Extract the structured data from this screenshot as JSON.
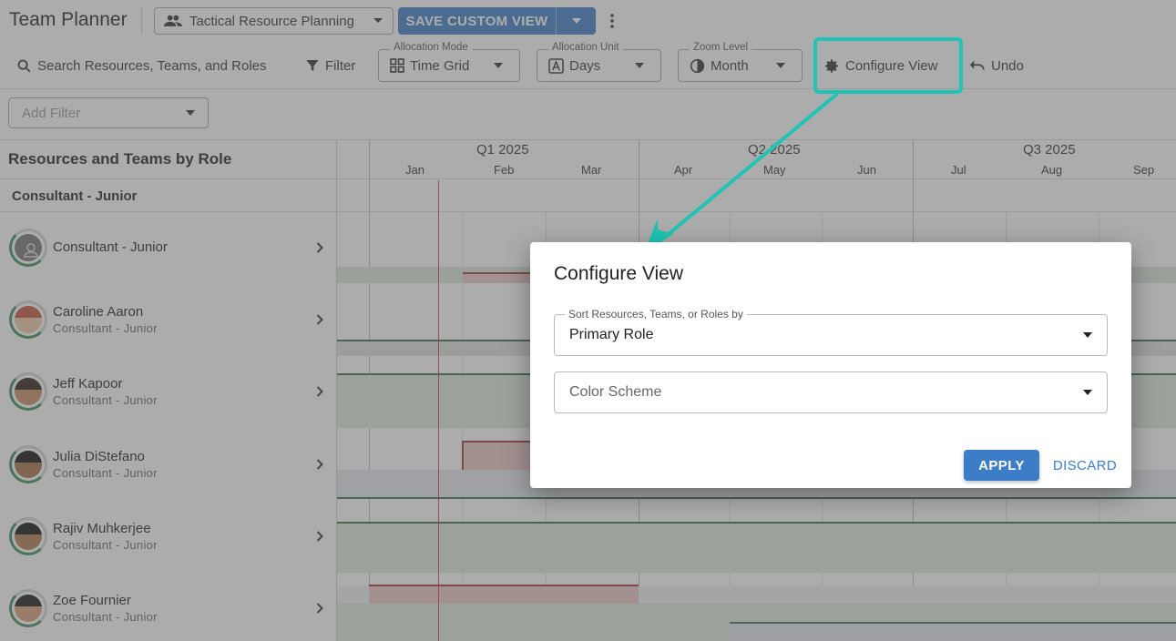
{
  "app": {
    "title": "Team Planner"
  },
  "view_selector": {
    "value": "Tactical Resource Planning"
  },
  "save_view": {
    "label": "SAVE CUSTOM VIEW"
  },
  "toolbar": {
    "search_label": "Search Resources, Teams, and Roles",
    "filter_label": "Filter",
    "allocation_mode": {
      "legend": "Allocation Mode",
      "value": "Time Grid"
    },
    "allocation_unit": {
      "legend": "Allocation Unit",
      "value": "Days"
    },
    "zoom_level": {
      "legend": "Zoom Level",
      "value": "Month"
    },
    "configure_label": "Configure View",
    "undo_label": "Undo"
  },
  "add_filter": {
    "placeholder": "Add Filter"
  },
  "left_panel": {
    "header": "Resources and Teams by Role",
    "group": "Consultant - Junior",
    "rows": [
      {
        "name": "Consultant - Junior",
        "role": ""
      },
      {
        "name": "Caroline Aaron",
        "role": "Consultant - Junior"
      },
      {
        "name": "Jeff Kapoor",
        "role": "Consultant - Junior"
      },
      {
        "name": "Julia DiStefano",
        "role": "Consultant - Junior"
      },
      {
        "name": "Rajiv Muhkerjee",
        "role": "Consultant - Junior"
      },
      {
        "name": "Zoe Fournier",
        "role": "Consultant - Junior"
      }
    ]
  },
  "timeline": {
    "quarters": [
      "Q1 2025",
      "Q2 2025",
      "Q3 2025"
    ],
    "months": [
      "Jan",
      "Feb",
      "Mar",
      "Apr",
      "May",
      "Jun",
      "Jul",
      "Aug",
      "Sep"
    ]
  },
  "dialog": {
    "title": "Configure View",
    "sort_legend": "Sort Resources, Teams, or Roles by",
    "sort_value": "Primary Role",
    "color_scheme_placeholder": "Color Scheme",
    "apply_label": "APPLY",
    "discard_label": "DISCARD"
  },
  "colors": {
    "primary": "#3d7cc6",
    "highlight": "#20c4b4",
    "over_allocated": "#c0504d",
    "allocated": "#3c6e4c"
  }
}
